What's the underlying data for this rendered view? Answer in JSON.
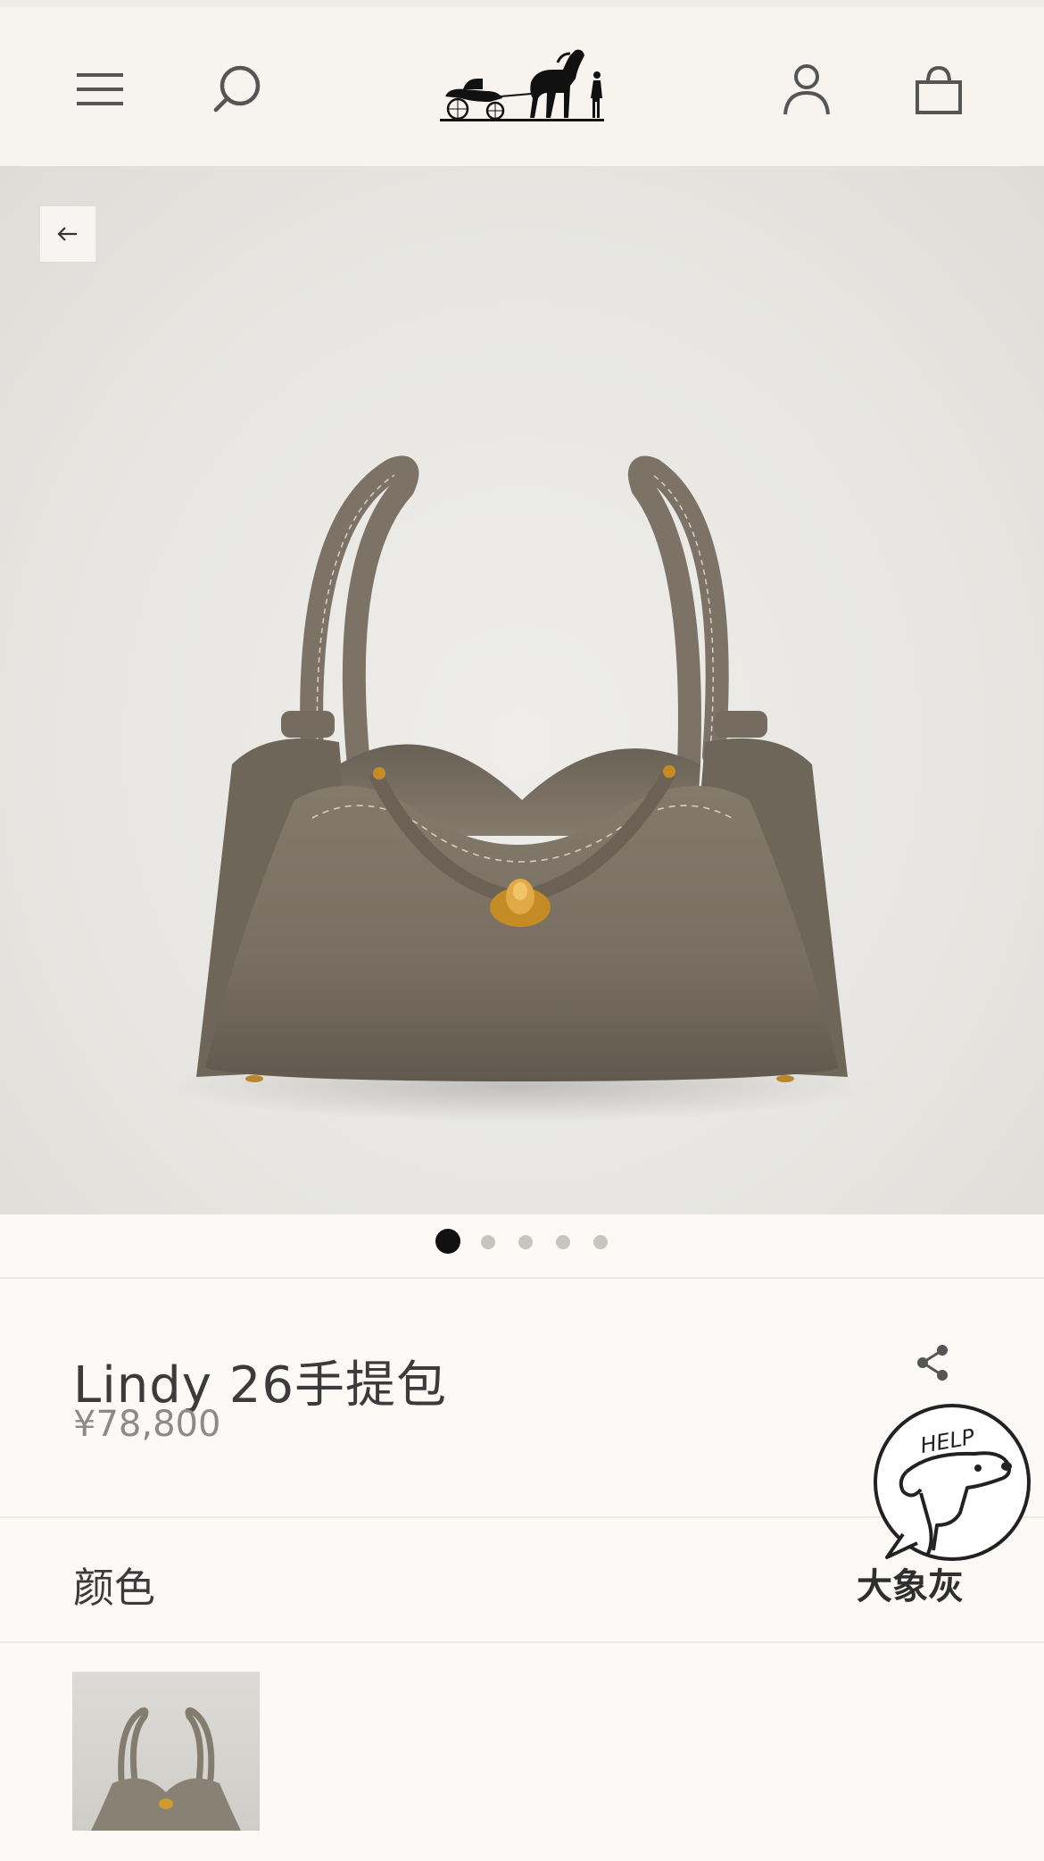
{
  "header": {
    "menu_icon": "hamburger-menu-icon",
    "search_icon": "search-icon",
    "logo": "horse-carriage-logo",
    "account_icon": "user-account-icon",
    "bag_icon": "shopping-bag-icon"
  },
  "hero": {
    "back_icon": "arrow-left-icon",
    "carousel": {
      "total": 5,
      "active_index": 0
    }
  },
  "product": {
    "title": "Lindy 26手提包",
    "price": "¥78,800",
    "share_icon": "share-icon"
  },
  "color_section": {
    "label": "颜色",
    "selected_value": "大象灰",
    "swatch_icon": "bag-thumbnail"
  },
  "help_badge": {
    "text": "HELP"
  },
  "colors": {
    "header_bg": "#f7f4f0",
    "page_bg": "#fcfaf7",
    "bag_leather": "#7b7164",
    "hardware_gold": "#d09a2e",
    "dot_active": "#111111",
    "dot_inactive": "#c8c5c0"
  }
}
